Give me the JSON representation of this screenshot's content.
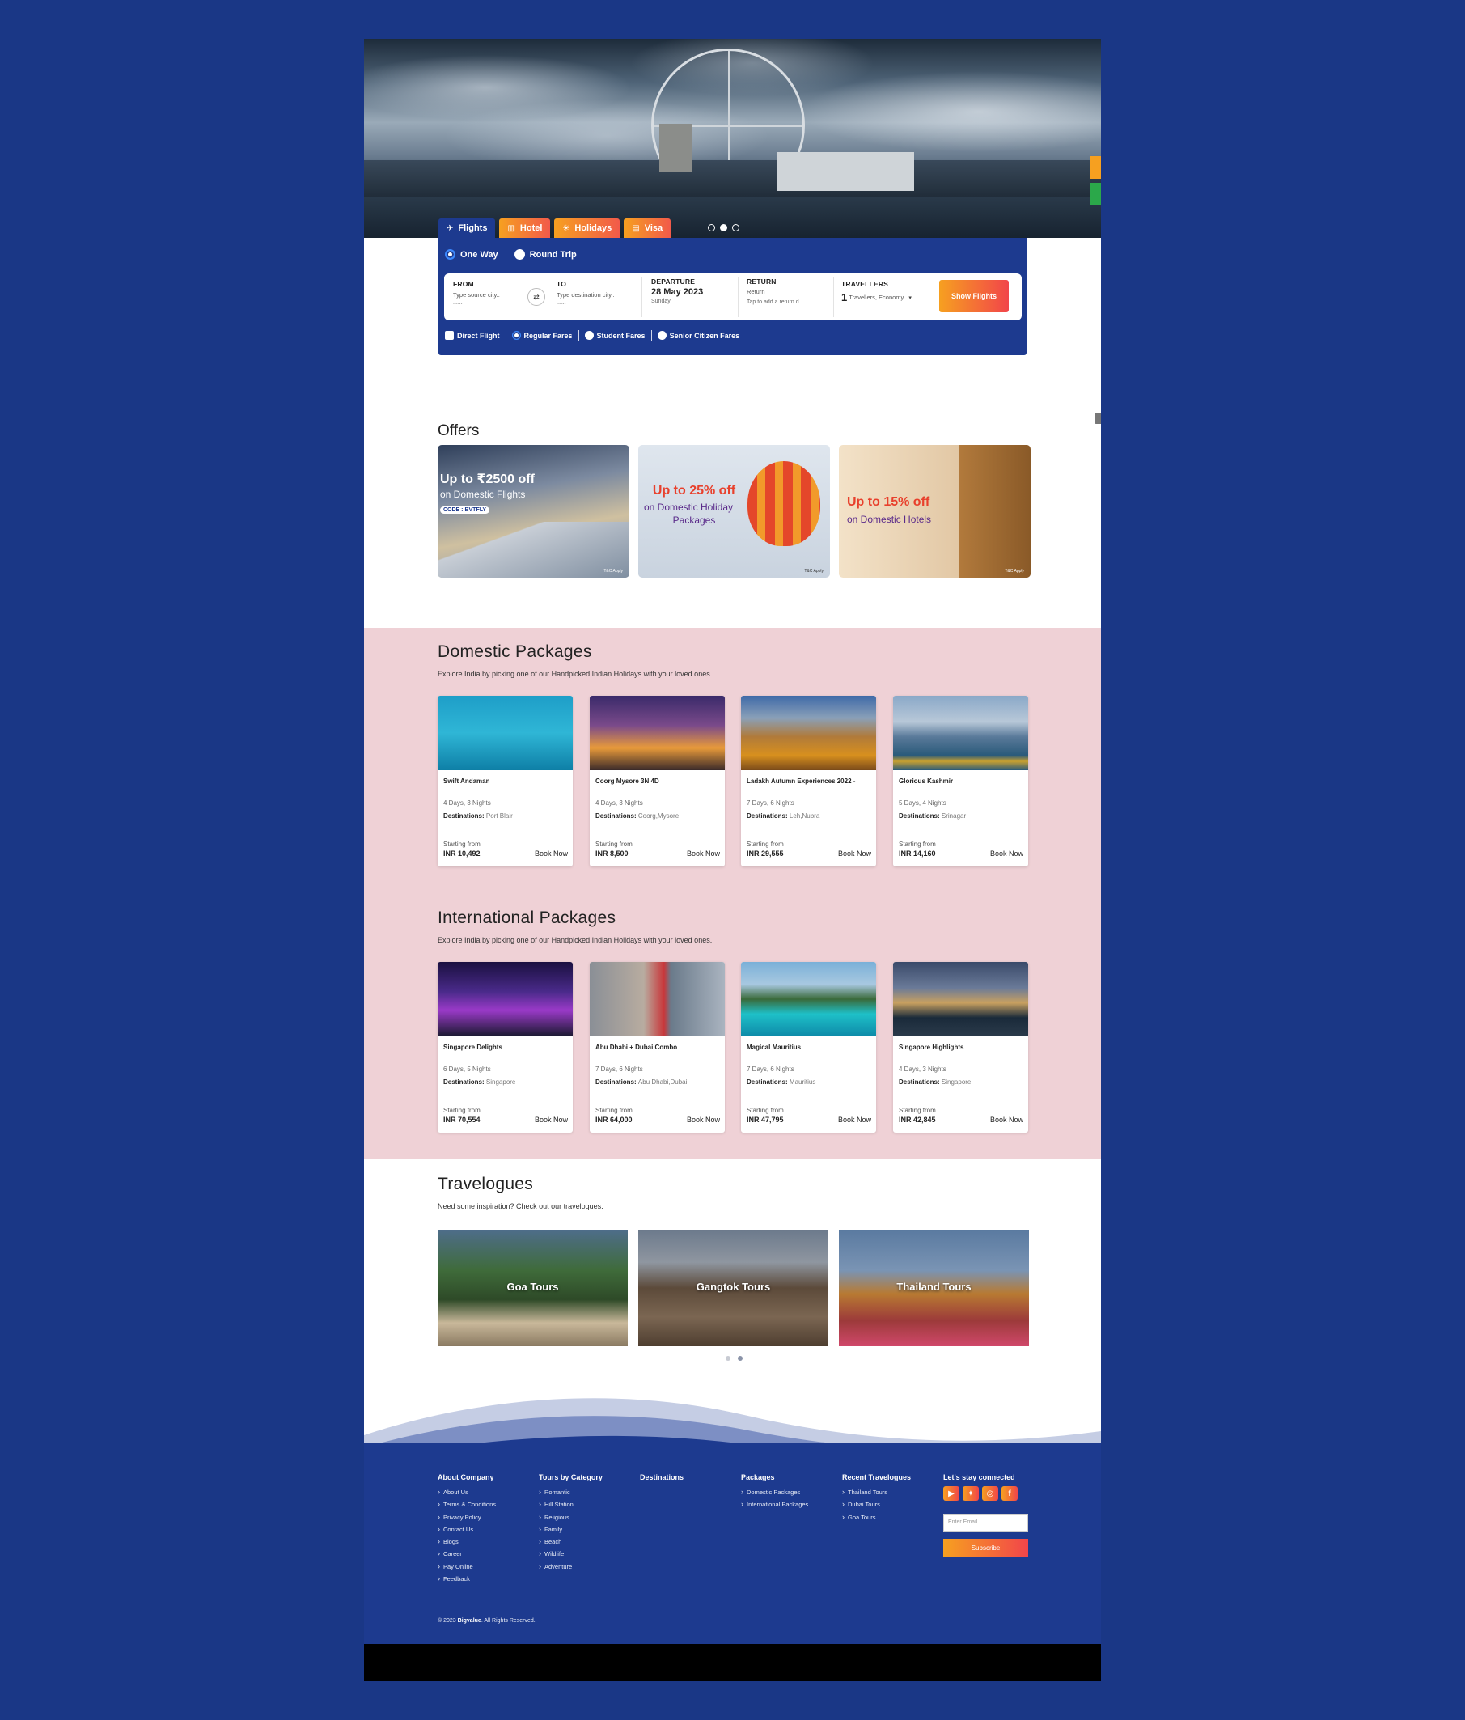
{
  "hero": {
    "slide_count": 3,
    "active_slide": 2
  },
  "tabs": [
    {
      "label": "Flights",
      "icon": "plane-icon"
    },
    {
      "label": "Hotel",
      "icon": "hotel-icon"
    },
    {
      "label": "Holidays",
      "icon": "holidays-icon"
    },
    {
      "label": "Visa",
      "icon": "visa-icon"
    }
  ],
  "search": {
    "trip_types": [
      "One Way",
      "Round Trip"
    ],
    "from": {
      "label": "FROM",
      "placeholder": "Type source city..",
      "extra": "......"
    },
    "to": {
      "label": "TO",
      "placeholder": "Type destination city..",
      "extra": "......"
    },
    "departure": {
      "label": "DEPARTURE",
      "date": "28 May 2023",
      "day": "Sunday"
    },
    "return": {
      "label": "RETURN",
      "value": "Return",
      "hint": "Tap to add a return d.."
    },
    "travellers": {
      "label": "TRAVELLERS",
      "count": "1",
      "text": "Travellers, Economy"
    },
    "button": "Show Flights",
    "fares": [
      "Direct Flight",
      "Regular Fares",
      "Student Fares",
      "Senior Citizen Fares"
    ]
  },
  "offers": {
    "title": "Offers",
    "items": [
      {
        "line1": "Up to ₹2500 off",
        "line2": "on Domestic Flights",
        "code": "CODE : BVTFLY",
        "tc": "T&C Apply"
      },
      {
        "line1": "Up to 25% off",
        "line2": "on Domestic Holiday",
        "line3": "Packages",
        "tc": "T&C Apply"
      },
      {
        "line1": "Up to 15% off",
        "line2": "on Domestic Hotels",
        "tc": "T&C Apply"
      }
    ]
  },
  "domestic": {
    "title": "Domestic Packages",
    "subtitle": "Explore India by picking one of our Handpicked Indian Holidays with your loved ones.",
    "cards": [
      {
        "name": "Swift Andaman",
        "duration": "4 Days, 3 Nights",
        "dest_label": "Destinations:",
        "dest": "Port Blair",
        "from": "Starting from",
        "price": "INR 10,492",
        "book": "Book Now"
      },
      {
        "name": "Coorg Mysore 3N 4D",
        "duration": "4 Days, 3 Nights",
        "dest_label": "Destinations:",
        "dest": "Coorg,Mysore",
        "from": "Starting from",
        "price": "INR 8,500",
        "book": "Book Now"
      },
      {
        "name": "Ladakh Autumn Experiences 2022 -",
        "duration": "7 Days, 6 Nights",
        "dest_label": "Destinations:",
        "dest": "Leh,Nubra",
        "from": "Starting from",
        "price": "INR 29,555",
        "book": "Book Now"
      },
      {
        "name": "Glorious Kashmir",
        "duration": "5 Days, 4 Nights",
        "dest_label": "Destinations:",
        "dest": "Srinagar",
        "from": "Starting from",
        "price": "INR 14,160",
        "book": "Book Now"
      }
    ]
  },
  "international": {
    "title": "International Packages",
    "subtitle": "Explore India by picking one of our Handpicked Indian Holidays with your loved ones.",
    "cards": [
      {
        "name": "Singapore Delights",
        "duration": "6 Days, 5 Nights",
        "dest_label": "Destinations:",
        "dest": "Singapore",
        "from": "Starting from",
        "price": "INR 70,554",
        "book": "Book Now"
      },
      {
        "name": "Abu Dhabi + Dubai Combo",
        "duration": "7 Days, 6 Nights",
        "dest_label": "Destinations:",
        "dest": "Abu Dhabi,Dubai",
        "from": "Starting from",
        "price": "INR 64,000",
        "book": "Book Now"
      },
      {
        "name": "Magical Mauritius",
        "duration": "7 Days, 6 Nights",
        "dest_label": "Destinations:",
        "dest": "Mauritius",
        "from": "Starting from",
        "price": "INR 47,795",
        "book": "Book Now"
      },
      {
        "name": "Singapore Highlights",
        "duration": "4 Days, 3 Nights",
        "dest_label": "Destinations:",
        "dest": "Singapore",
        "from": "Starting from",
        "price": "INR 42,845",
        "book": "Book Now"
      }
    ]
  },
  "travelogues": {
    "title": "Travelogues",
    "subtitle": "Need some inspiration? Check out our travelogues.",
    "items": [
      "Goa Tours",
      "Gangtok Tours",
      "Thailand Tours"
    ]
  },
  "footer": {
    "about": {
      "title": "About Company",
      "links": [
        "About Us",
        "Terms & Conditions",
        "Privacy Policy",
        "Contact Us",
        "Blogs",
        "Career",
        "Pay Online",
        "Feedback"
      ]
    },
    "category": {
      "title": "Tours by Category",
      "links": [
        "Romantic",
        "Hill Station",
        "Religious",
        "Family",
        "Beach",
        "Wildlife",
        "Adventure"
      ]
    },
    "destinations": {
      "title": "Destinations"
    },
    "packages": {
      "title": "Packages",
      "links": [
        "Domestic Packages",
        "International Packages"
      ]
    },
    "recent": {
      "title": "Recent Travelogues",
      "links": [
        "Thailand Tours",
        "Dubai Tours",
        "Goa Tours"
      ]
    },
    "connect": {
      "title": "Let's stay connected",
      "email_placeholder": "Enter Email",
      "subscribe": "Subscribe"
    },
    "copyright_pre": "© 2023",
    "brand": "Bigvalue",
    "copyright_post": ". All Rights Reserved."
  },
  "colors": {
    "brand_blue": "#1d3a8f",
    "accent_orange": "#f6a020",
    "accent_red": "#f2454a",
    "pink_bg": "#efd1d6"
  }
}
